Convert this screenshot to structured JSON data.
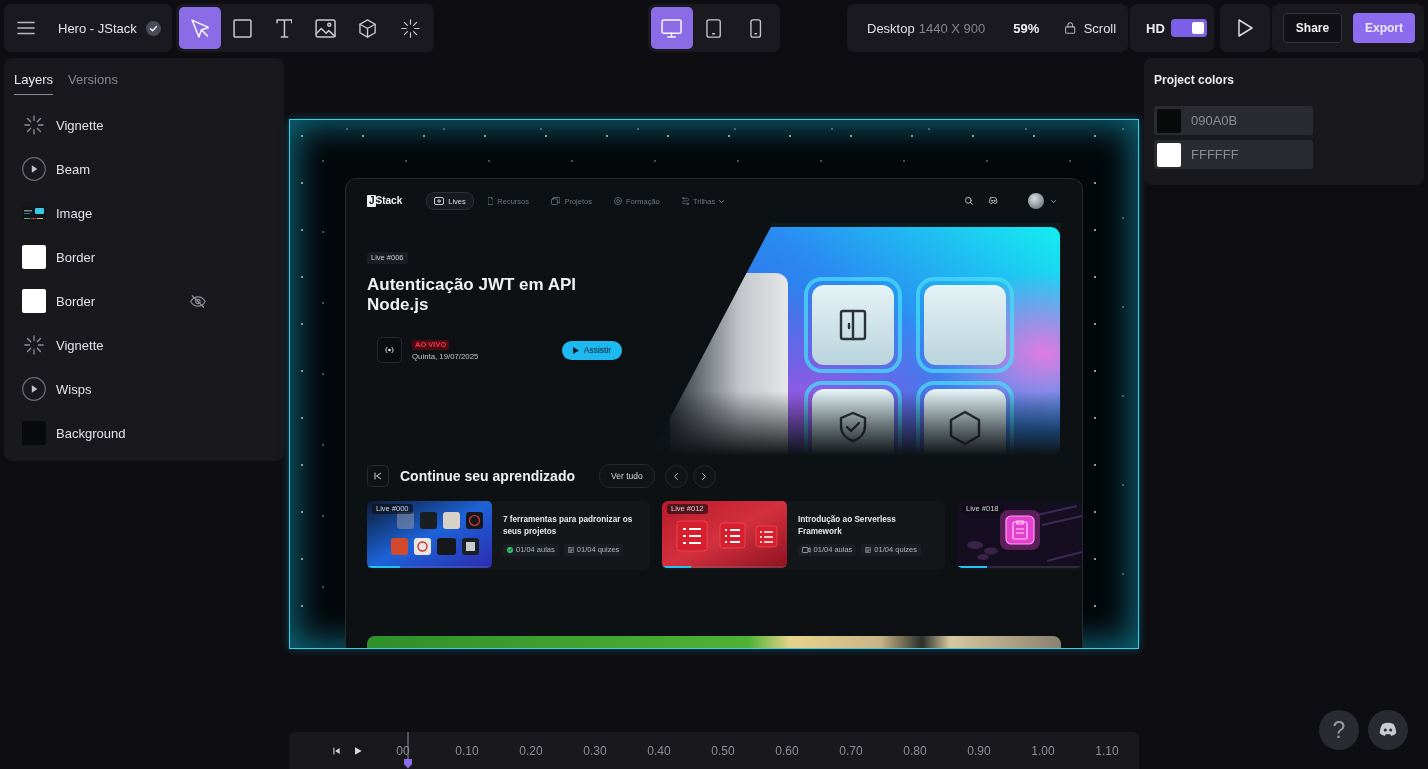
{
  "toolbar": {
    "project_title": "Hero - JStack",
    "tools": [
      {
        "kind": "select",
        "selected": true
      },
      {
        "kind": "rectangle",
        "selected": false
      },
      {
        "kind": "text",
        "selected": false
      },
      {
        "kind": "image",
        "selected": false
      },
      {
        "kind": "shape3d",
        "selected": false
      },
      {
        "kind": "effect",
        "selected": false
      }
    ],
    "devices": [
      {
        "kind": "desktop",
        "selected": true
      },
      {
        "kind": "tablet",
        "selected": false
      },
      {
        "kind": "phone",
        "selected": false
      }
    ],
    "viewport": {
      "device": "Desktop",
      "size": "1440 X 900",
      "zoom": "59%",
      "scroll": "Scroll"
    },
    "hd": {
      "label": "HD",
      "on": true
    },
    "share": "Share",
    "export": "Export"
  },
  "layers_panel": {
    "tabs": [
      {
        "label": "Layers",
        "selected": true
      },
      {
        "label": "Versions",
        "selected": false
      }
    ],
    "layers": [
      {
        "name": "Vignette",
        "kind": "effect",
        "hidden": false
      },
      {
        "name": "Beam",
        "kind": "animation",
        "hidden": false
      },
      {
        "name": "Image",
        "kind": "image",
        "hidden": false
      },
      {
        "name": "Border",
        "kind": "fill",
        "color": "#ffffff",
        "hidden": false
      },
      {
        "name": "Border",
        "kind": "fill",
        "color": "#ffffff",
        "hidden": true
      },
      {
        "name": "Vignette",
        "kind": "effect",
        "hidden": false
      },
      {
        "name": "Wisps",
        "kind": "animation",
        "hidden": false
      },
      {
        "name": "Background",
        "kind": "fill",
        "color": "#090a0b",
        "hidden": false
      }
    ]
  },
  "canvas": {
    "preview": {
      "nav": {
        "logo": "JStack",
        "links": [
          {
            "label": "Lives",
            "kind": "live",
            "selected": true,
            "dropdown": false
          },
          {
            "label": "Recursos",
            "kind": "file",
            "selected": false,
            "dropdown": false
          },
          {
            "label": "Projetos",
            "kind": "folder",
            "selected": false,
            "dropdown": false
          },
          {
            "label": "Formação",
            "kind": "target",
            "selected": false,
            "dropdown": false
          },
          {
            "label": "Trilhas",
            "kind": "route",
            "selected": false,
            "dropdown": true
          }
        ]
      },
      "hero": {
        "tag": "Live #006",
        "title": "Autenticação JWT em API Node.js",
        "status": "AO VIVO",
        "date": "Quinta, 19/07/2025",
        "button": "Assistir"
      },
      "section": {
        "title": "Continue seu aprendizado",
        "see_all": "Ver tudo"
      },
      "cards": [
        {
          "kind": "tools",
          "tag": "Live #000",
          "title": "7 ferramentas para padronizar os seus projetos",
          "lessons": "01/04 aulas",
          "lessons_done": true,
          "quizzes": "01/04 quizes",
          "level": 0.26
        },
        {
          "kind": "serverless",
          "tag": "Live #012",
          "title": "Introdução ao Serverless Framework",
          "lessons": "01/04 aulas",
          "lessons_done": false,
          "quizzes": "01/04 quizes",
          "level": 0.23
        },
        {
          "kind": "neon",
          "tag": "Live #018",
          "level": 0.24
        }
      ]
    }
  },
  "project_colors": {
    "title": "Project colors",
    "colors": [
      {
        "hex": "090A0B",
        "color": "#090a0b"
      },
      {
        "hex": "FFFFFF",
        "color": "#ffffff"
      }
    ]
  },
  "timeline": {
    "ticks": [
      "00",
      "0.10",
      "0.20",
      "0.30",
      "0.40",
      "0.50",
      "0.60",
      "0.70",
      "0.80",
      "0.90",
      "1.00",
      "1.10"
    ]
  },
  "help": {
    "label": "?"
  }
}
